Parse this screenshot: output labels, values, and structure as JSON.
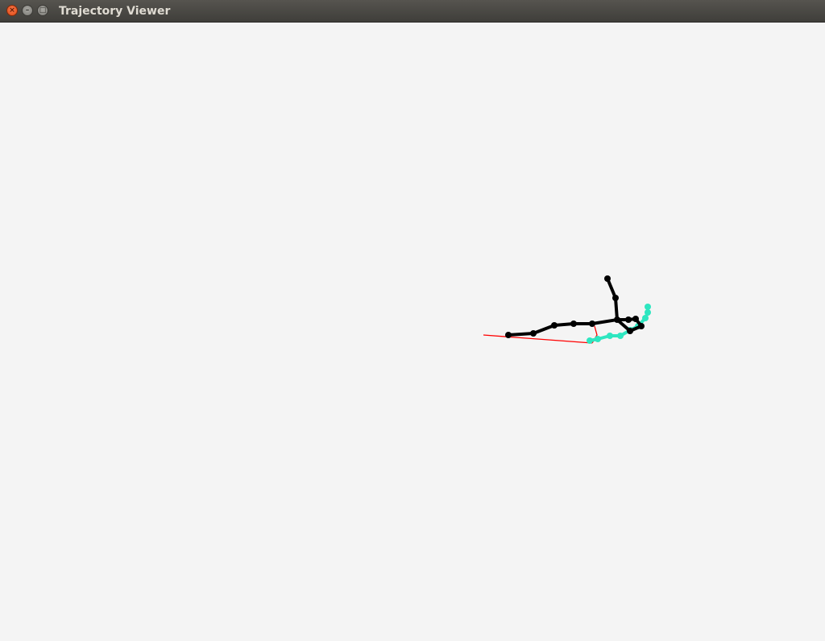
{
  "window": {
    "title": "Trajectory Viewer",
    "controls": {
      "close_icon": "close-icon",
      "minimize_icon": "minimize-icon",
      "maximize_icon": "maximize-icon"
    }
  },
  "colors": {
    "canvas_background": "#f4f4f4",
    "skeleton": "#000000",
    "trajectory": "#2ee6c0",
    "reference_line": "#ff0000"
  }
}
